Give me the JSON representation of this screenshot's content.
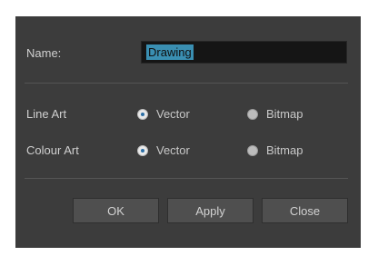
{
  "dialog": {
    "name_label": "Name:",
    "name_value": "Drawing",
    "line_art": {
      "label": "Line Art",
      "options": [
        "Vector",
        "Bitmap"
      ],
      "selected": "Vector"
    },
    "colour_art": {
      "label": "Colour Art",
      "options": [
        "Vector",
        "Bitmap"
      ],
      "selected": "Vector"
    },
    "buttons": {
      "ok": "OK",
      "apply": "Apply",
      "close": "Close"
    }
  }
}
